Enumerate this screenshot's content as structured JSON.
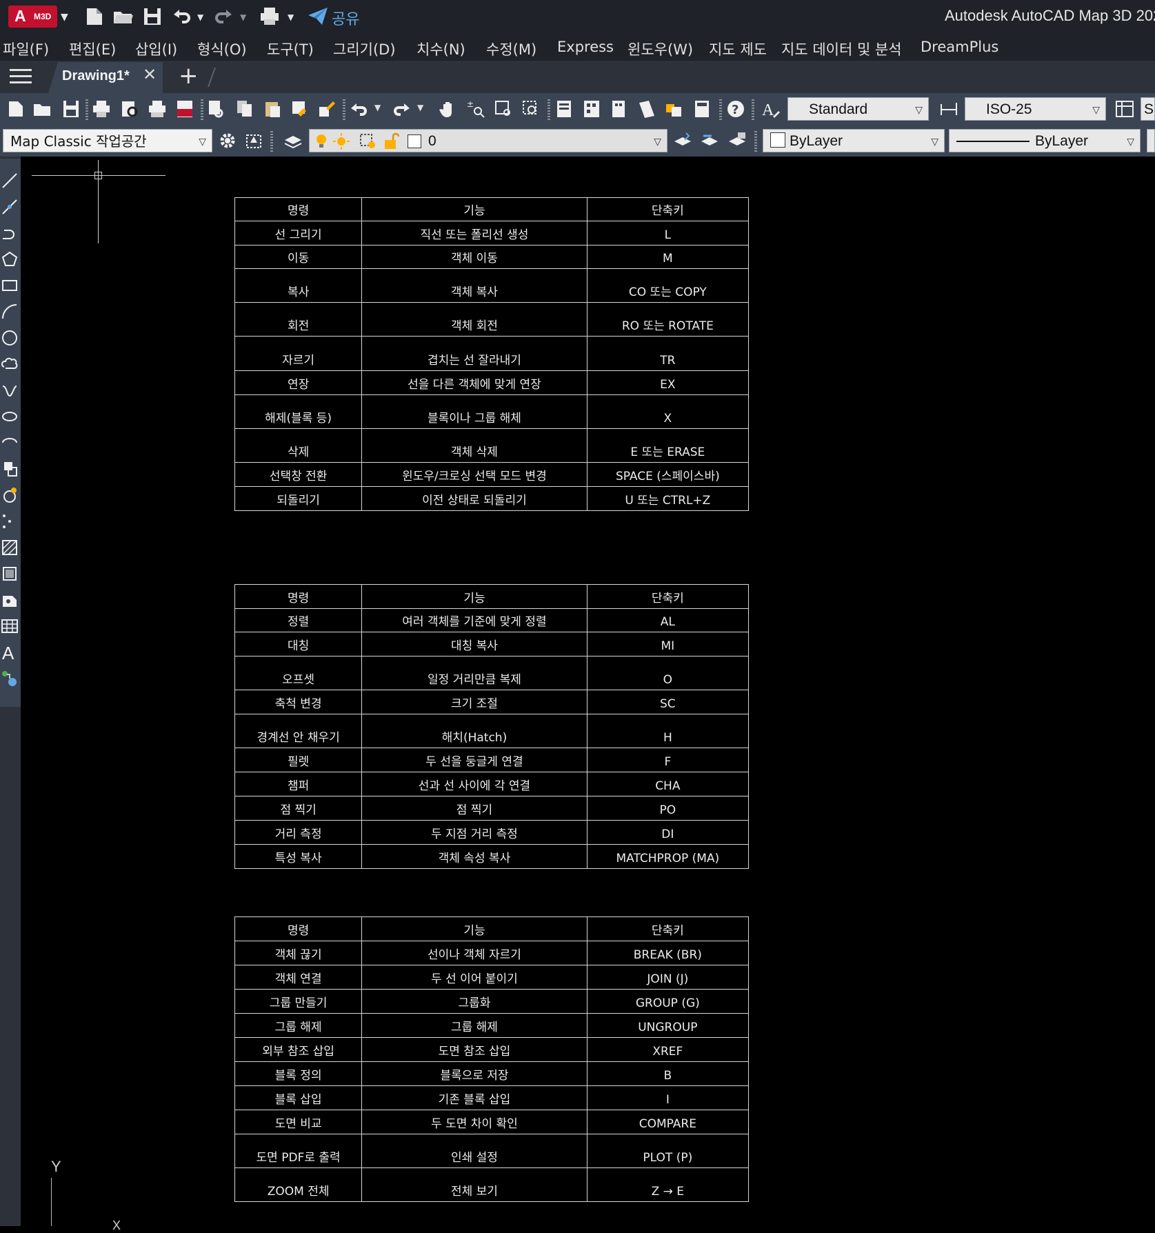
{
  "window": {
    "app_logo_letter": "A",
    "app_logo_badge": "M3D",
    "share_label": "공유",
    "title": "Autodesk AutoCAD Map 3D 202"
  },
  "menu": [
    "파일(F)",
    "편집(E)",
    "삽입(I)",
    "형식(O)",
    "도구(T)",
    "그리기(D)",
    "치수(N)",
    "수정(M)",
    "Express",
    "윈도우(W)",
    "지도 제도",
    "지도 데이터 및 분석",
    "DreamPlus"
  ],
  "tabs": {
    "active": "Drawing1*",
    "close": "✕",
    "add": "+"
  },
  "toolbar": {
    "text_style": "Standard",
    "dim_style": "ISO-25",
    "table_style_partial": "S",
    "workspace": "Map Classic 작업공간",
    "layer": "0",
    "color": "ByLayer",
    "linetype": "ByLayer"
  },
  "tables": [
    {
      "headers": [
        "명령",
        "기능",
        "단축키"
      ],
      "rows": [
        [
          "선 그리기",
          "직선 또는 폴리선 생성",
          "L"
        ],
        [
          "이동",
          "객체 이동",
          "M"
        ],
        [
          "복사",
          "객체 복사",
          "CO 또는 COPY"
        ],
        [
          "회전",
          "객체 회전",
          "RO 또는 ROTATE"
        ],
        [
          "자르기",
          "겹치는 선 잘라내기",
          "TR"
        ],
        [
          "연장",
          "선을 다른 객체에 맞게 연장",
          "EX"
        ],
        [
          "해제(블록 등)",
          "블록이나 그룹 해체",
          "X"
        ],
        [
          "삭제",
          "객체 삭제",
          "E 또는 ERASE"
        ],
        [
          "선택창 전환",
          "윈도우/크로싱 선택 모드 변경",
          "SPACE (스페이스바)"
        ],
        [
          "되돌리기",
          "이전 상태로 되돌리기",
          "U 또는 CTRL+Z"
        ]
      ]
    },
    {
      "headers": [
        "명령",
        "기능",
        "단축키"
      ],
      "rows": [
        [
          "정렬",
          "여러 객체를 기준에 맞게 정렬",
          "AL"
        ],
        [
          "대칭",
          "대칭 복사",
          "MI"
        ],
        [
          "오프셋",
          "일정 거리만큼 복제",
          "O"
        ],
        [
          "축척 변경",
          "크기 조절",
          "SC"
        ],
        [
          "경계선 안 채우기",
          "해치(Hatch)",
          "H"
        ],
        [
          "필렛",
          "두 선을 둥글게 연결",
          "F"
        ],
        [
          "챔퍼",
          "선과 선 사이에 각 연결",
          "CHA"
        ],
        [
          "점 찍기",
          "점 찍기",
          "PO"
        ],
        [
          "거리 측정",
          "두 지점 거리 측정",
          "DI"
        ],
        [
          "특성 복사",
          "객체 속성 복사",
          "MATCHPROP (MA)"
        ]
      ]
    },
    {
      "headers": [
        "명령",
        "기능",
        "단축키"
      ],
      "rows": [
        [
          "객체 끊기",
          "선이나 객체 자르기",
          "BREAK (BR)"
        ],
        [
          "객체 연결",
          "두 선 이어 붙이기",
          "JOIN (J)"
        ],
        [
          "그룹 만들기",
          "그룹화",
          "GROUP (G)"
        ],
        [
          "그룹 해제",
          "그룹 해제",
          "UNGROUP"
        ],
        [
          "외부 참조 삽입",
          "도면 참조 삽입",
          "XREF"
        ],
        [
          "블록 정의",
          "블록으로 저장",
          "B"
        ],
        [
          "블록 삽입",
          "기존 블록 삽입",
          "I"
        ],
        [
          "도면 비교",
          "두 도면 차이 확인",
          "COMPARE"
        ],
        [
          "도면 PDF로 출력",
          "인쇄 설정",
          "PLOT (P)"
        ],
        [
          "ZOOM 전체",
          "전체 보기",
          "Z → E"
        ]
      ]
    }
  ],
  "ucs": {
    "y_label": "Y",
    "x_label": "X"
  }
}
